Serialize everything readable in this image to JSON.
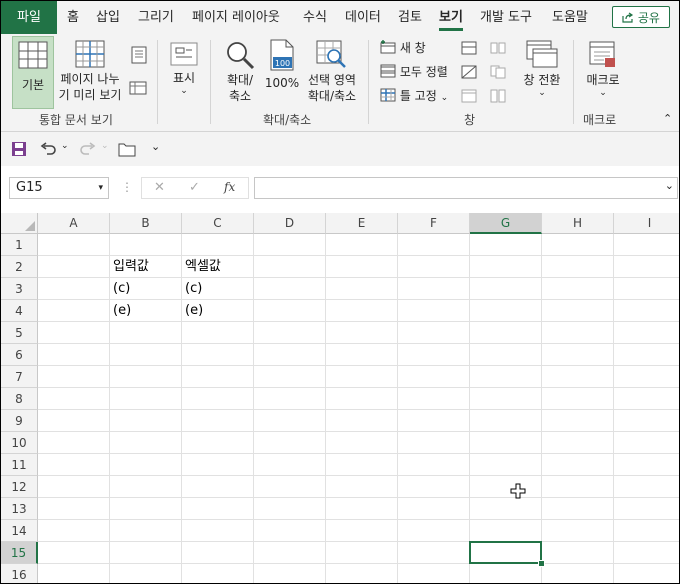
{
  "ribbon_tabs": {
    "file": "파일",
    "home": "홈",
    "insert": "삽입",
    "draw": "그리기",
    "page_layout": "페이지 레이아웃",
    "formulas": "수식",
    "data": "데이터",
    "review": "검토",
    "view": "보기",
    "developer": "개발 도구",
    "help": "도움말",
    "share": "공유"
  },
  "ribbon": {
    "normal": "기본",
    "page_break_1": "페이지 나누",
    "page_break_2": "기 미리 보기",
    "workbook_views_label": "통합 문서 보기",
    "show": "표시",
    "zoom_1": "확대/",
    "zoom_2": "축소",
    "zoom100": "100%",
    "zoom_badge": "100",
    "zoom_sel_1": "선택 영역",
    "zoom_sel_2": "확대/축소",
    "zoom_label": "확대/축소",
    "new_window": "새 창",
    "arrange_all": "모두 정렬",
    "freeze_panes": "틀 고정",
    "switch_windows": "창 전환",
    "window_label": "창",
    "macros": "매크로",
    "macros_label": "매크로"
  },
  "formula_bar": {
    "name_box": "G15",
    "cancel": "✕",
    "enter": "✓",
    "fx": "fx",
    "formula": ""
  },
  "sheet": {
    "columns": [
      "A",
      "B",
      "C",
      "D",
      "E",
      "F",
      "G",
      "H",
      "I"
    ],
    "rows": [
      "1",
      "2",
      "3",
      "4",
      "5",
      "6",
      "7",
      "8",
      "9",
      "10",
      "11",
      "12",
      "13",
      "14",
      "15",
      "16"
    ],
    "selected_column": "G",
    "selected_row": "15",
    "active_cell": "G15",
    "cells": {
      "B2": "입력값",
      "C2": "엑셀값",
      "B3": "(c)",
      "C3": "(c)",
      "B4": "(e)",
      "C4": "(e)"
    }
  },
  "colors": {
    "accent": "#217346",
    "ribbon_bg": "#f3f3f3",
    "gridline": "#e1e1e1"
  }
}
